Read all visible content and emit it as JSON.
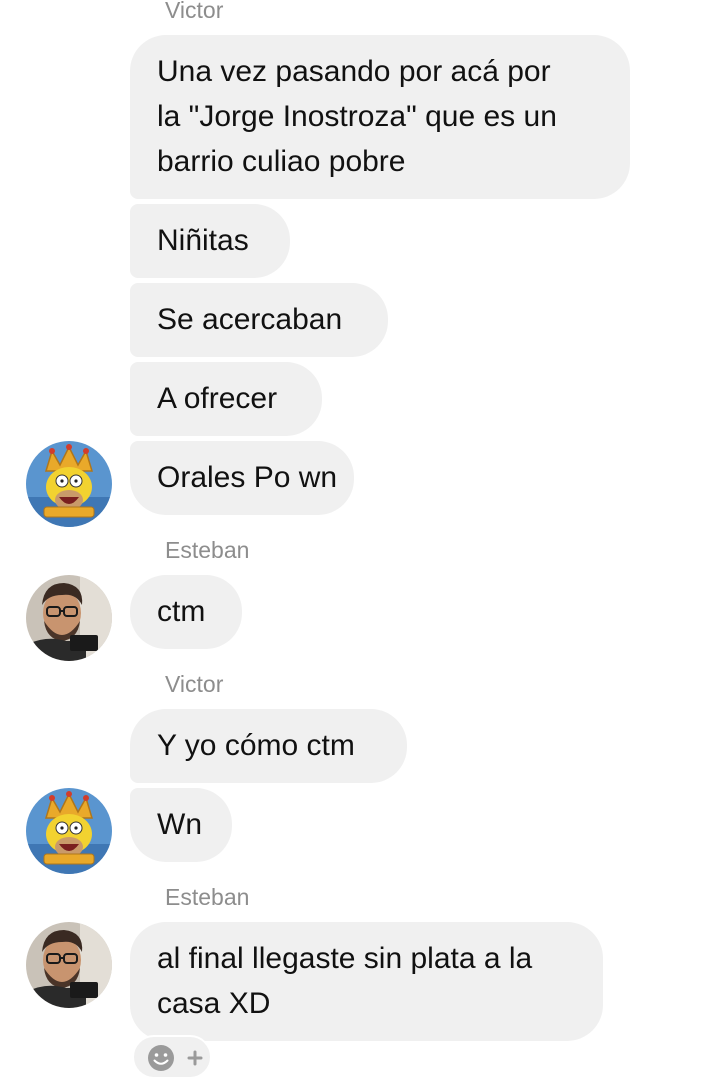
{
  "conversation": {
    "blocks": [
      {
        "sender": "Victor",
        "messages": [
          [
            "Una vez pasando por acá por",
            "la \"Jorge Inostroza\" que es un",
            "barrio culiao pobre"
          ],
          [
            "Niñitas"
          ],
          [
            "Se acercaban"
          ],
          [
            "A ofrecer"
          ],
          [
            "Orales Po wn"
          ]
        ]
      },
      {
        "sender": "Esteban",
        "messages": [
          [
            "ctm"
          ]
        ]
      },
      {
        "sender": "Victor",
        "messages": [
          [
            "Y yo cómo ctm"
          ],
          [
            "Wn"
          ]
        ]
      },
      {
        "sender": "Esteban",
        "messages": [
          [
            "al final llegaste sin plata a la",
            "casa XD"
          ]
        ]
      }
    ]
  },
  "avatars": {
    "victor": "homer-king-avatar",
    "esteban": "man-with-glasses-avatar"
  },
  "reaction": {
    "icon": "smiley-face-icon",
    "add_icon": "plus-icon"
  },
  "colors": {
    "bubble_bg": "#f0f0f0",
    "bubble_text": "#111111",
    "sender_name": "#8d8d8d"
  }
}
